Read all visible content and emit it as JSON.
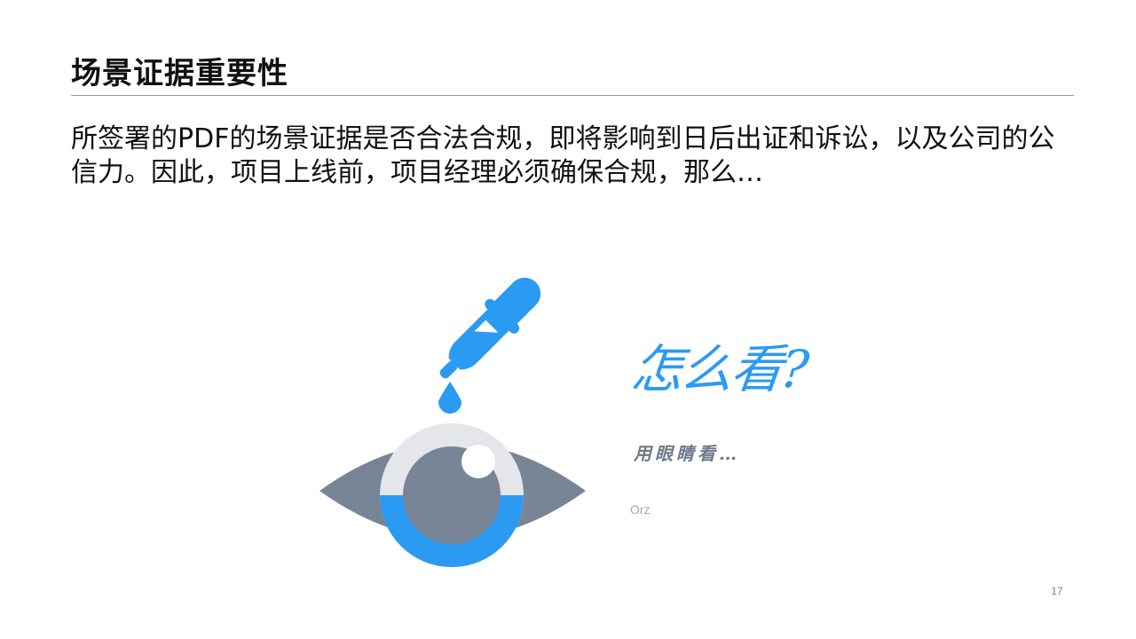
{
  "slide": {
    "title": "场景证据重要性",
    "body": "所签署的PDF的场景证据是否合法合规，即将影响到日后出证和诉讼，以及公司的公信力。因此，项目上线前，项目经理必须确保合规，那么…",
    "callout": {
      "question": "怎么看?",
      "answer": "用眼睛看…",
      "aside": "Orz"
    },
    "illustration": {
      "icon": "eye-dropper-icon",
      "colors": {
        "accent": "#2b9af3",
        "eye": "#788596",
        "iris_ring": "#e4e6e9"
      }
    },
    "page_number": "17"
  }
}
